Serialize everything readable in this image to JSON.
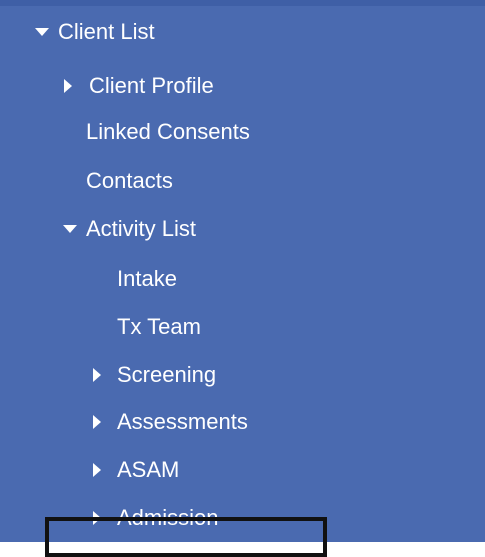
{
  "tree": {
    "items": [
      {
        "id": "client-list",
        "label": "Client List",
        "expander": "expanded"
      },
      {
        "id": "client-profile",
        "label": "Client Profile",
        "expander": "collapsed"
      },
      {
        "id": "linked-consents",
        "label": "Linked Consents",
        "expander": "none"
      },
      {
        "id": "contacts",
        "label": "Contacts",
        "expander": "none"
      },
      {
        "id": "activity-list",
        "label": "Activity List",
        "expander": "expanded"
      },
      {
        "id": "intake",
        "label": "Intake",
        "expander": "none"
      },
      {
        "id": "tx-team",
        "label": "Tx Team",
        "expander": "none"
      },
      {
        "id": "screening",
        "label": "Screening",
        "expander": "collapsed"
      },
      {
        "id": "assessments",
        "label": "Assessments",
        "expander": "collapsed"
      },
      {
        "id": "asam",
        "label": "ASAM",
        "expander": "collapsed"
      },
      {
        "id": "admission",
        "label": "Admission",
        "expander": "collapsed",
        "highlighted": true
      }
    ]
  },
  "colors": {
    "background": "#4a6ab0",
    "text": "#ffffff",
    "highlight_border": "#111111"
  },
  "icons": {
    "expanded": "caret-down-icon",
    "collapsed": "caret-right-icon"
  }
}
